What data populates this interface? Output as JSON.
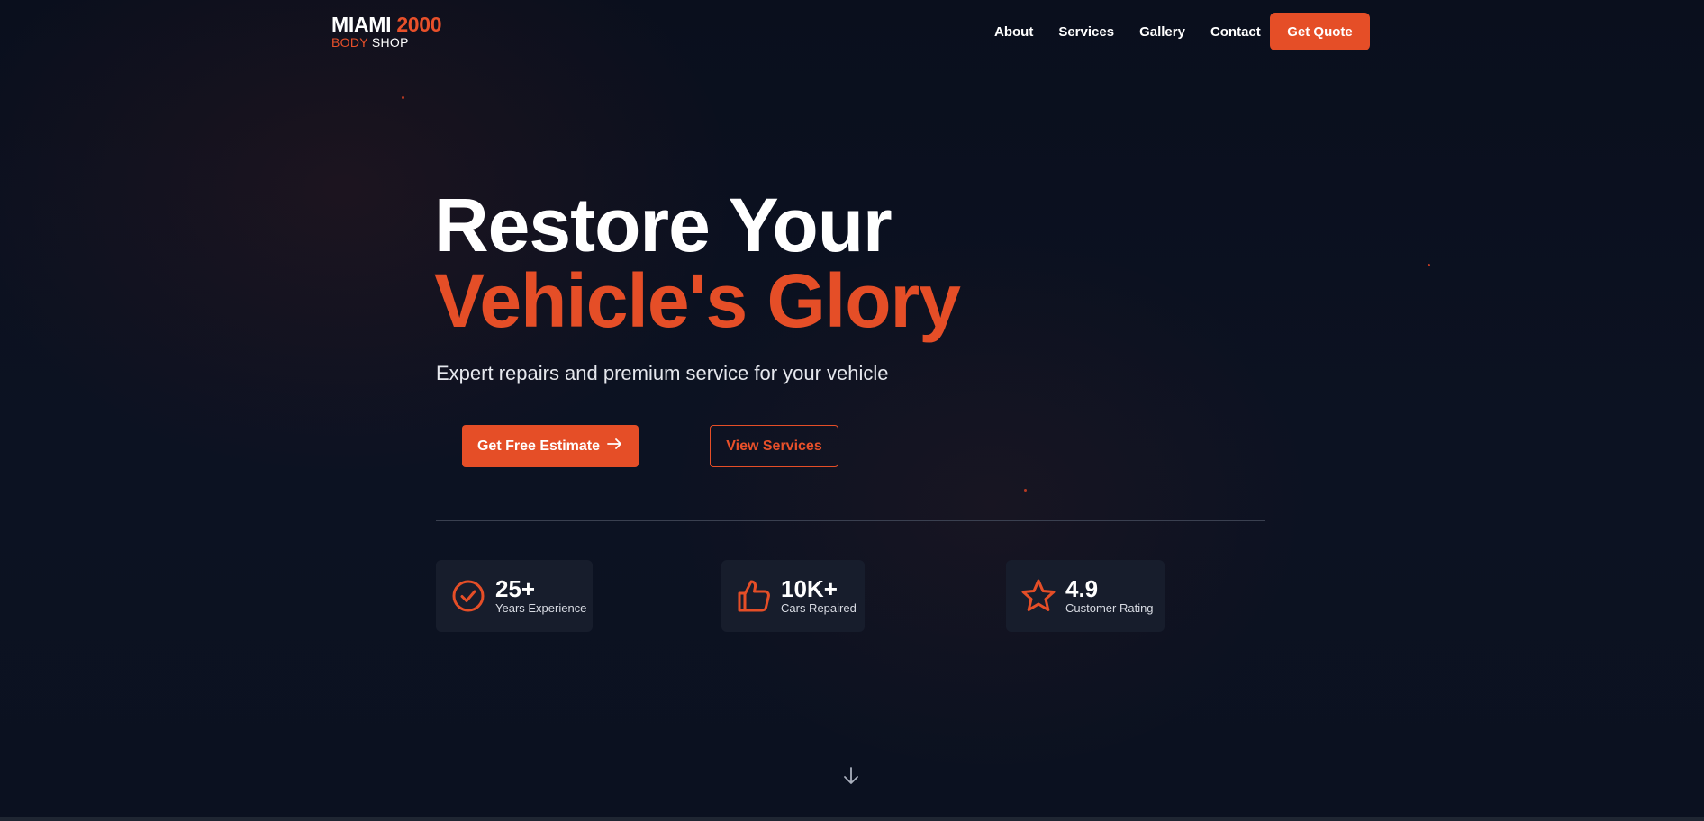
{
  "brand": {
    "name_main": "MIAMI",
    "name_accent": "2000",
    "sub_accent": "BODY",
    "sub_main": "SHOP"
  },
  "nav": {
    "items": [
      {
        "label": "About"
      },
      {
        "label": "Services"
      },
      {
        "label": "Gallery"
      },
      {
        "label": "Contact"
      }
    ],
    "cta_label": "Get Quote"
  },
  "hero": {
    "title_line1": "Restore Your",
    "title_line2": "Vehicle's Glory",
    "subtitle": "Expert repairs and premium service for your vehicle",
    "primary_button": "Get Free Estimate",
    "primary_button_icon": "arrow-right-icon",
    "secondary_button": "View Services"
  },
  "stats": [
    {
      "value": "25+",
      "label": "Years Experience",
      "icon": "check-circle-icon"
    },
    {
      "value": "10K+",
      "label": "Cars Repaired",
      "icon": "thumbs-up-icon"
    },
    {
      "value": "4.9",
      "label": "Customer Rating",
      "icon": "star-icon"
    }
  ],
  "scroll_icon": "arrow-down-icon",
  "colors": {
    "accent": "#e54e27",
    "background": "#0b1120",
    "card": "#171d2c",
    "text": "#ffffff"
  }
}
